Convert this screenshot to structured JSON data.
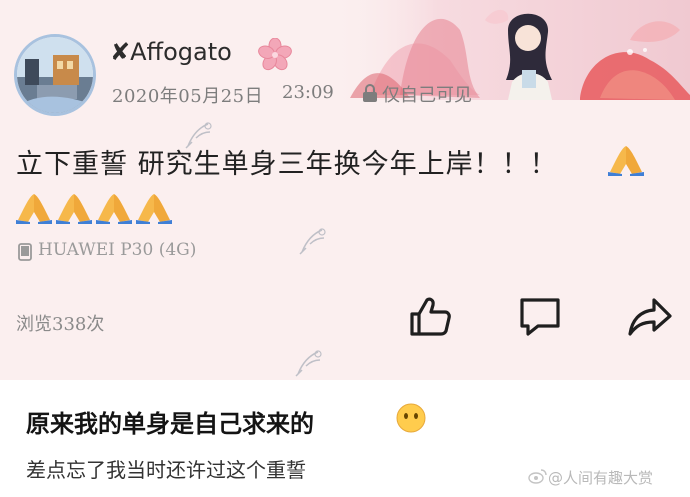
{
  "post": {
    "username": "Affogato",
    "username_prefix": "✘",
    "date": "2020年05月25日",
    "time": "23:09",
    "privacy": "仅自己可见",
    "content": "立下重誓 研究生单身三年换今年上岸！！！",
    "device": "HUAWEI P30 (4G)",
    "views": "浏览338次",
    "icons": {
      "badge": "sakura-icon",
      "privacy": "lock-icon",
      "device": "phone-icon",
      "emoji_pray": "folded-hands-icon",
      "like": "thumbs-up-icon",
      "comment": "comment-bubble-icon",
      "share": "share-arrow-icon"
    }
  },
  "caption": {
    "title": "原来我的单身是自己求来的",
    "emoji": "no-mouth-face-icon",
    "subtitle": "差点忘了我当时还许过这个重誓",
    "watermark": "@人间有趣大赏"
  },
  "colors": {
    "post_bg": "#fbefef",
    "text_primary": "#222222",
    "text_muted": "#7d7d7d",
    "accent_pink": "#f3a7b8",
    "accent_red": "#e2575a"
  }
}
